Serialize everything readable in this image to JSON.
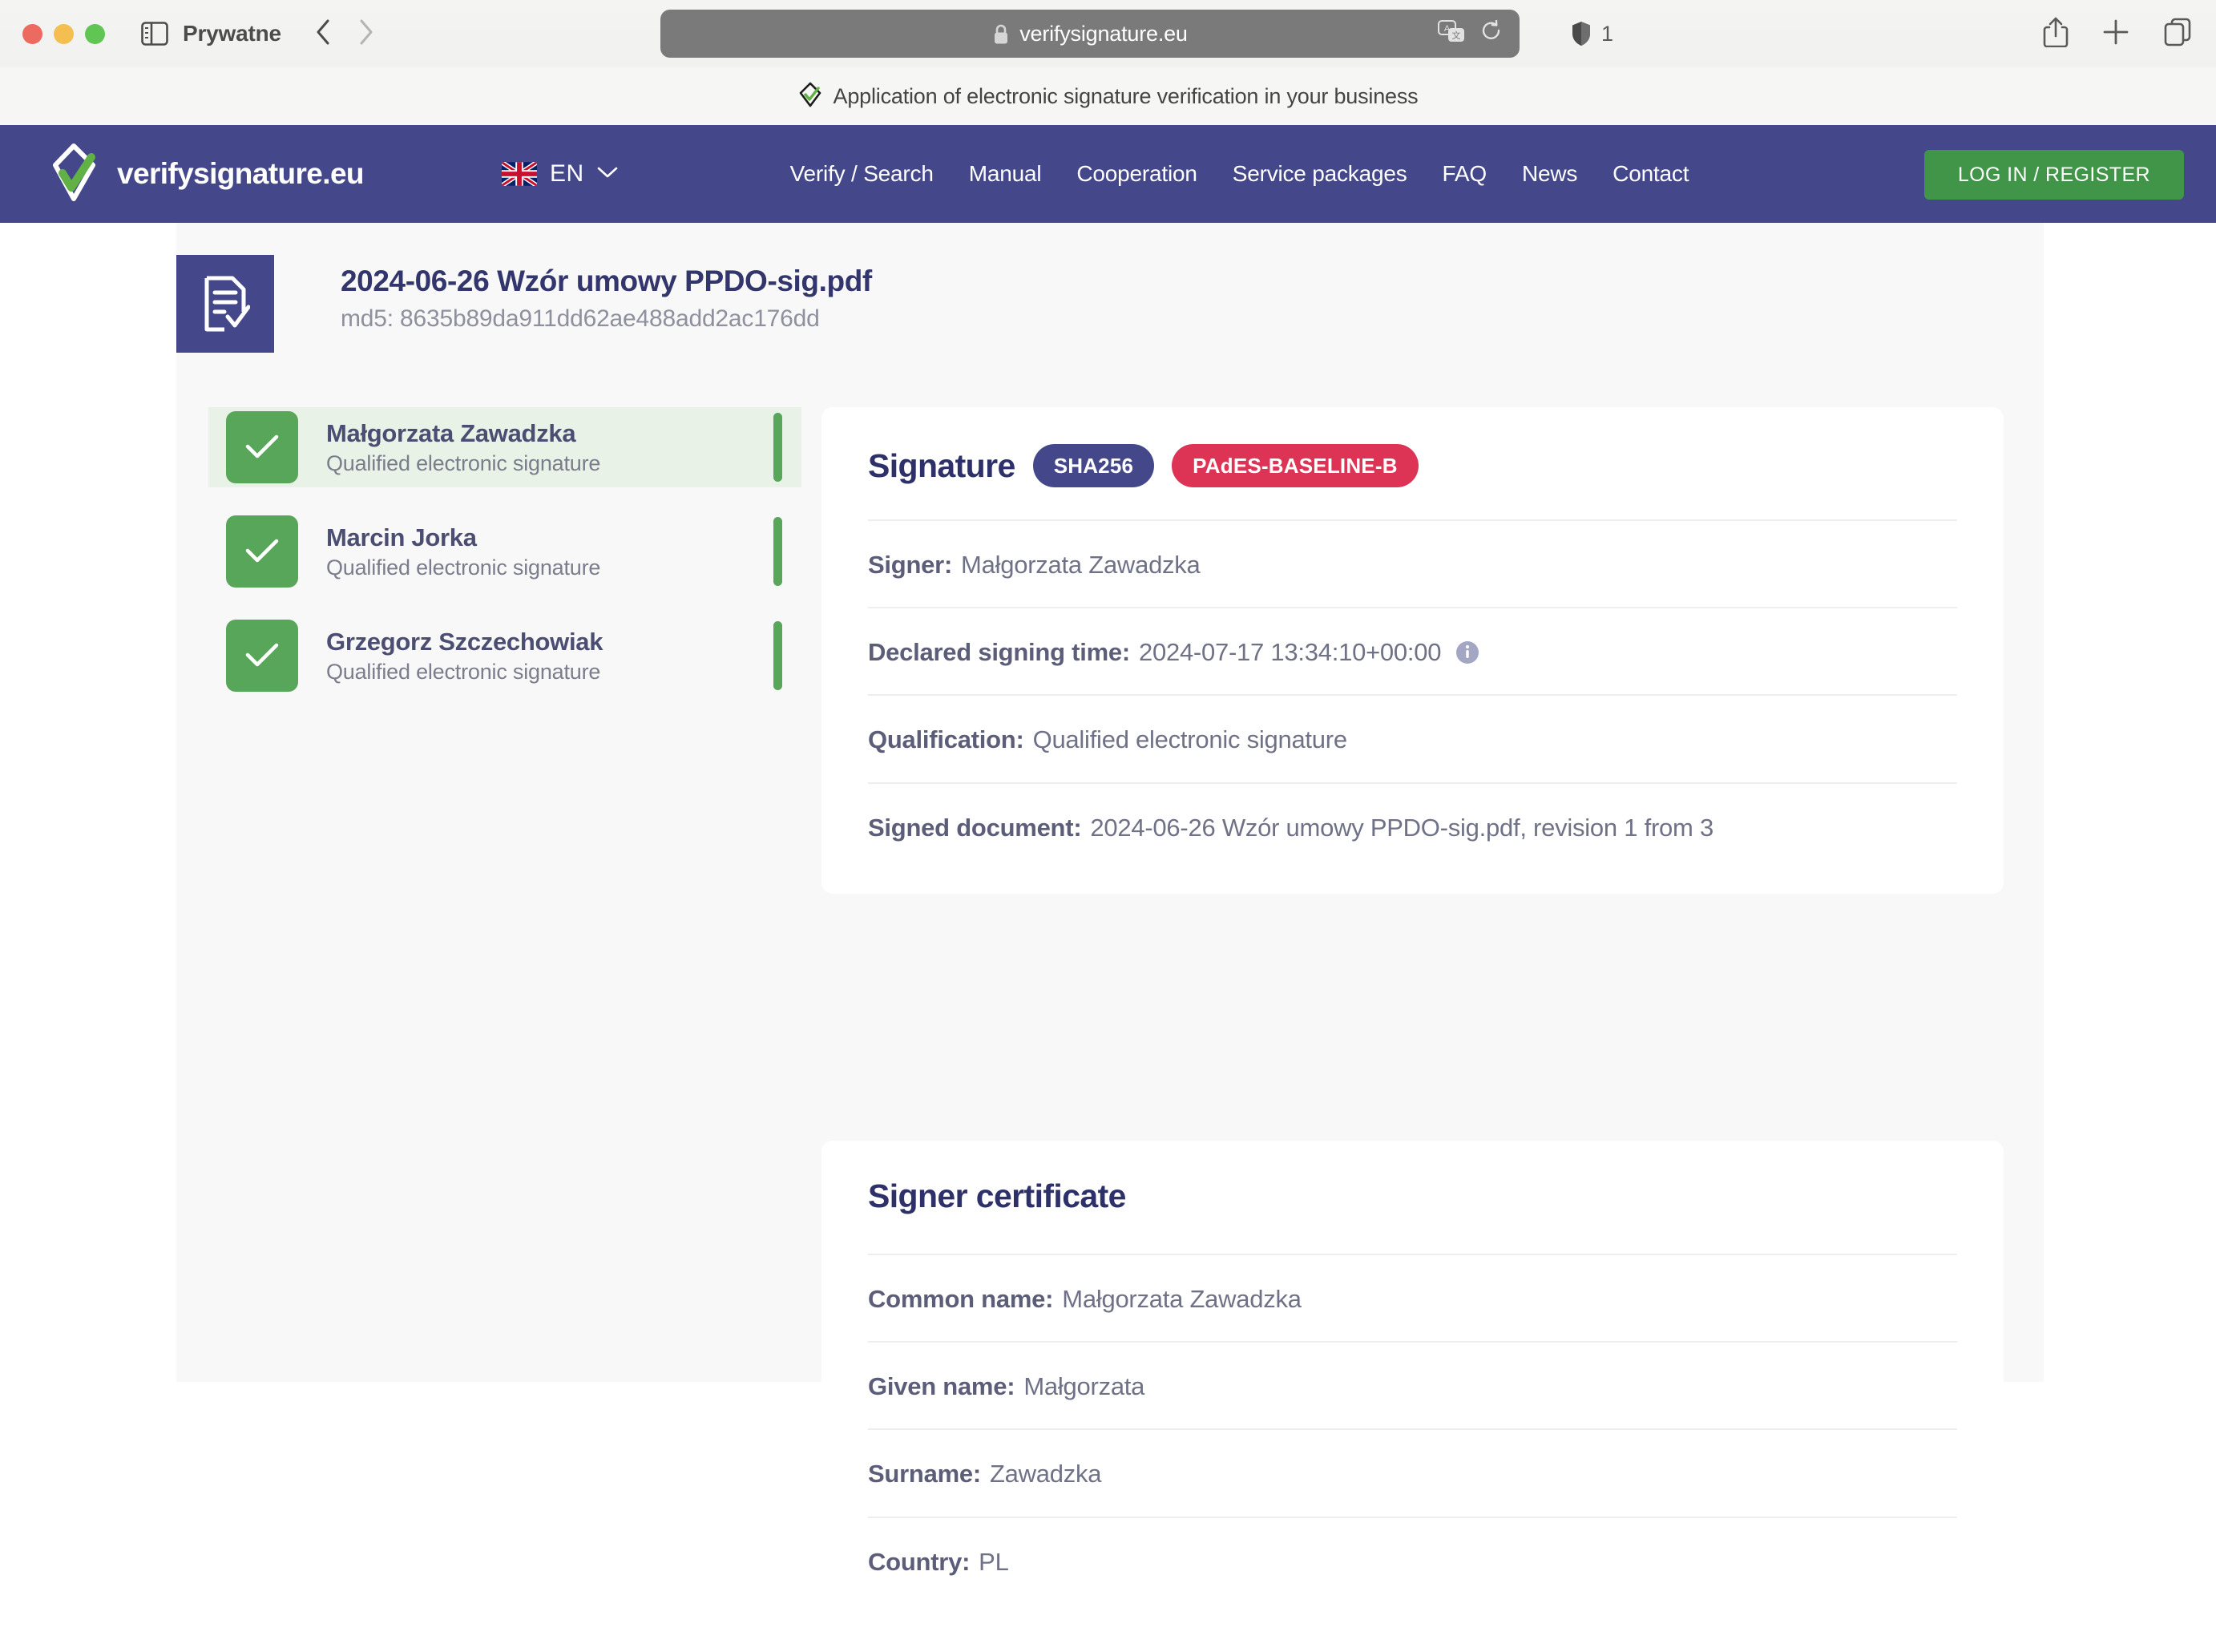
{
  "browser": {
    "private_label": "Prywatne",
    "url": "verifysignature.eu",
    "tracker_count": "1",
    "tab_title": "Application of electronic signature verification in your business"
  },
  "site_header": {
    "brand_name": "verifysignature.eu",
    "language": "EN",
    "nav": [
      {
        "label": "Verify / Search"
      },
      {
        "label": "Manual"
      },
      {
        "label": "Cooperation"
      },
      {
        "label": "Service packages"
      },
      {
        "label": "FAQ"
      },
      {
        "label": "News"
      },
      {
        "label": "Contact"
      }
    ],
    "login_label": "LOG IN / REGISTER",
    "colors": {
      "header_bg": "#44488a",
      "login_bg": "#419549"
    }
  },
  "document": {
    "name": "2024-06-26 Wzór umowy PPDO-sig.pdf",
    "md5": "md5: 8635b89da911dd62ae488add2ac176dd"
  },
  "signers": [
    {
      "name": "Małgorzata Zawadzka",
      "type": "Qualified electronic signature",
      "status": "valid",
      "active": true
    },
    {
      "name": "Marcin Jorka",
      "type": "Qualified electronic signature",
      "status": "valid",
      "active": false
    },
    {
      "name": "Grzegorz Szczechowiak",
      "type": "Qualified electronic signature",
      "status": "valid",
      "active": false
    }
  ],
  "signature_card": {
    "title": "Signature",
    "badges": [
      {
        "label": "SHA256",
        "color": "#44488a"
      },
      {
        "label": "PAdES-BASELINE-B",
        "color": "#dd3355"
      }
    ],
    "rows": [
      {
        "label": "Signer:",
        "value": "Małgorzata Zawadzka",
        "info": false
      },
      {
        "label": "Declared signing time:",
        "value": "2024-07-17 13:34:10+00:00",
        "info": true
      },
      {
        "label": "Qualification:",
        "value": "Qualified electronic signature",
        "info": false
      },
      {
        "label": "Signed document:",
        "value": "2024-06-26 Wzór umowy PPDO-sig.pdf, revision 1 from 3",
        "info": false
      }
    ]
  },
  "certificate_card": {
    "title": "Signer certificate",
    "rows": [
      {
        "label": "Common name:",
        "value": "Małgorzata Zawadzka"
      },
      {
        "label": "Given name:",
        "value": "Małgorzata"
      },
      {
        "label": "Surname:",
        "value": "Zawadzka"
      },
      {
        "label": "Country:",
        "value": "PL"
      }
    ]
  }
}
